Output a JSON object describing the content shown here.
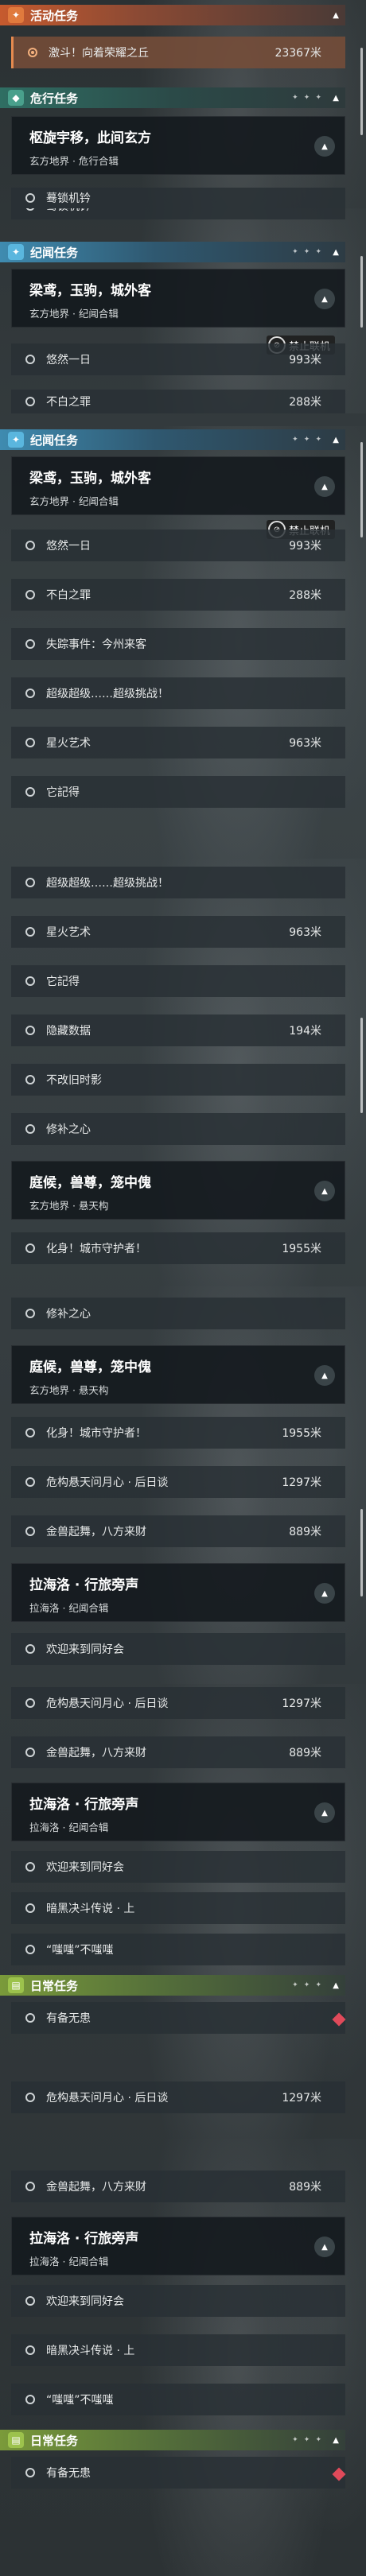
{
  "sections": {
    "activity": "活动任务",
    "danger": "危行任务",
    "story": "纪闻任务",
    "daily": "日常任务"
  },
  "quests": {
    "q1": {
      "title": "枢旋宇移，此间玄方",
      "sub": "玄方地界 · 危行合辑"
    },
    "q2": {
      "title": "梁鸢，玉驹，城外客",
      "sub": "玄方地界 · 纪闻合辑"
    },
    "q3": {
      "title": "庭候，兽尊，笼中傀",
      "sub": "玄方地界 · 悬天构"
    },
    "q4": {
      "title": "拉海洛 · 行旅旁声",
      "sub": "拉海洛 · 纪闻合辑"
    }
  },
  "items": {
    "activity1": {
      "label": "激斗！向着荣耀之丘",
      "dist": "23367米"
    },
    "qilin": "蓦锁机钤",
    "youran": {
      "label": "悠然一日",
      "dist": "993米"
    },
    "buzhi": {
      "label": "不白之罪",
      "dist": "288米"
    },
    "shizong": "失踪事件：今州来客",
    "chaoji": "超级超级……超级挑战！",
    "xinghuo": {
      "label": "星火艺术",
      "dist": "963米"
    },
    "taji": "它記得",
    "yincang": {
      "label": "隐藏数据",
      "dist": "194米"
    },
    "bugai": "不改旧时影",
    "xiubu": "修补之心",
    "huashen": {
      "label": "化身！城市守护者！",
      "dist": "1955米"
    },
    "weiyu": {
      "label": "危构悬天问月心 · 后日谈",
      "dist": "1297米"
    },
    "jinshan": {
      "label": "金兽起舞，八方来财",
      "dist": "889米"
    },
    "huanying": "欢迎来到同好会",
    "anhei": "暗黑决斗传说 · 上",
    "chichi": "“嗤嗤”不嗤嗤",
    "youbei": "有备无患"
  },
  "badge": "禁止联机",
  "icons": {
    "activity": "fire-icon",
    "danger": "gem-icon",
    "story": "star-icon",
    "daily": "book-icon",
    "expand": "triangle-up-icon",
    "no_coop": "no-coop-icon",
    "alert": "diamond-icon"
  }
}
